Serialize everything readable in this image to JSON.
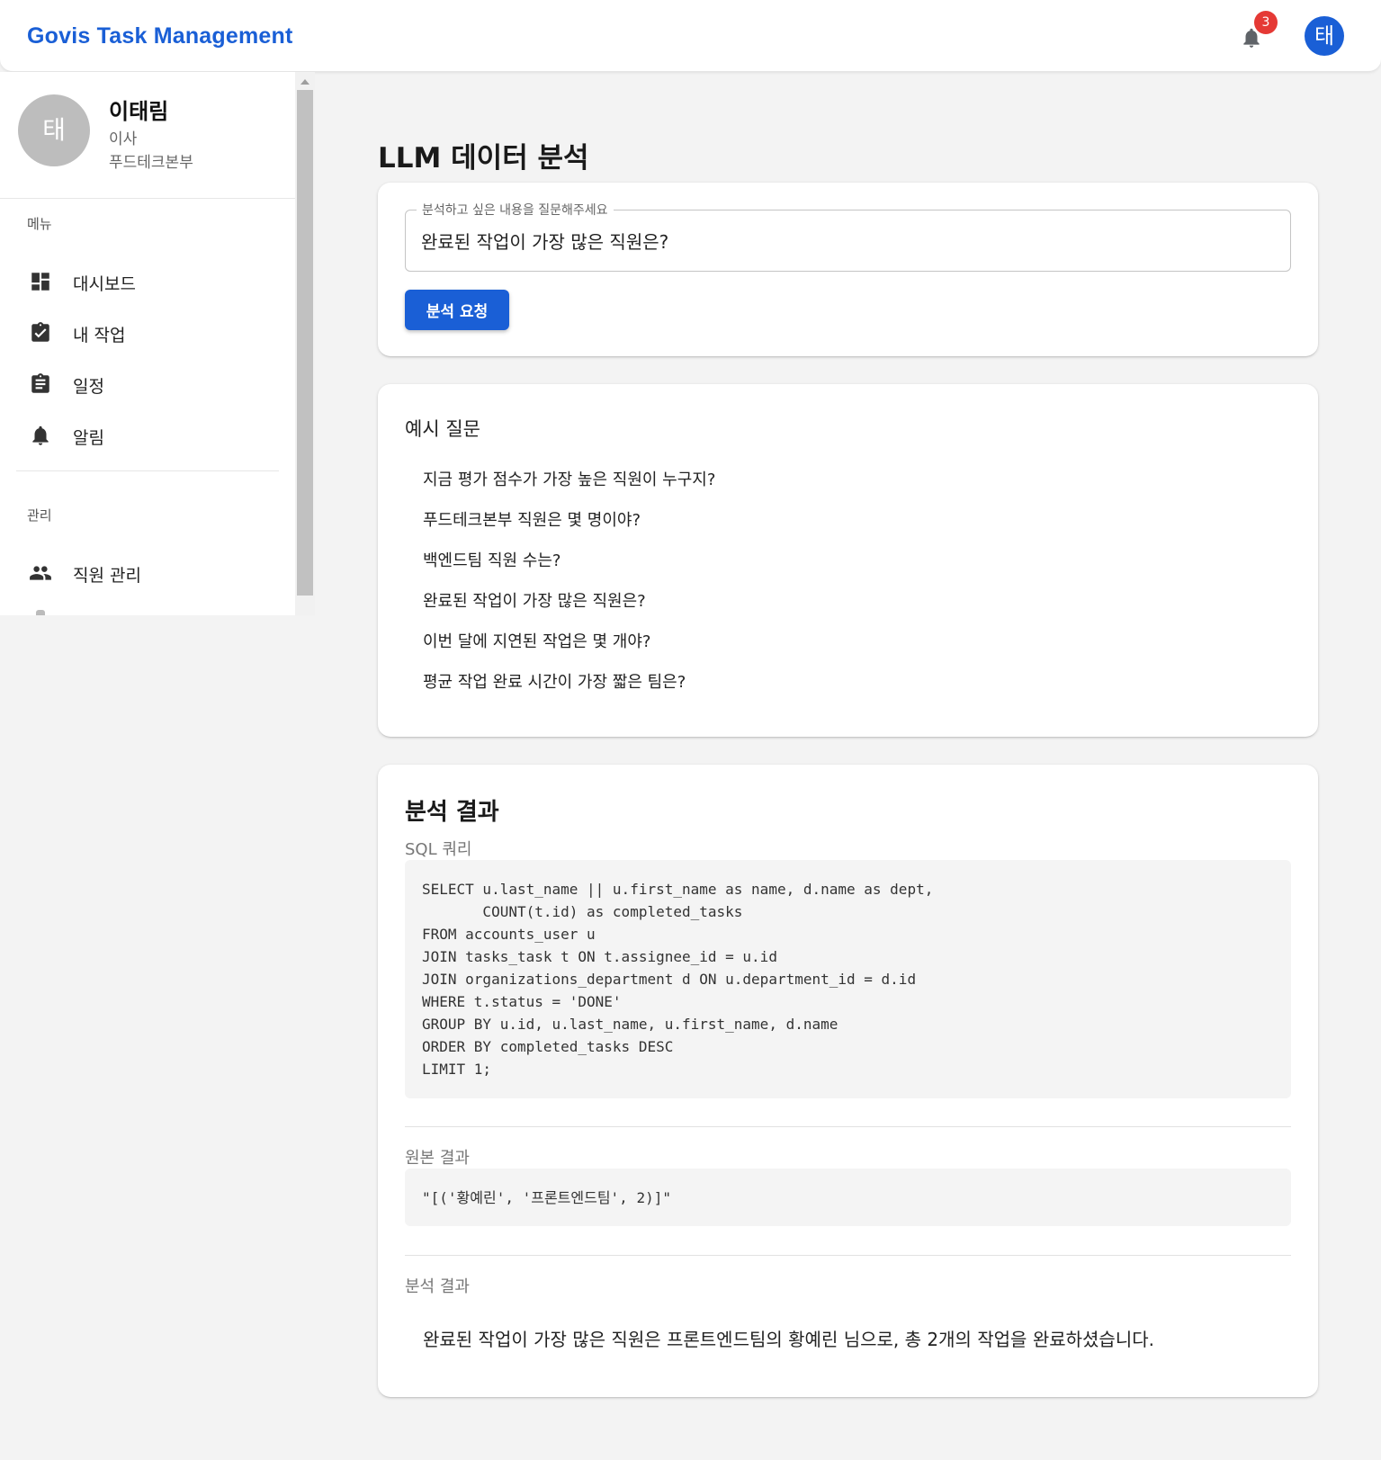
{
  "app": {
    "title": "Govis Task Management",
    "notification_count": "3",
    "user_initial": "태",
    "brand_color": "#1a5fd6",
    "badge_color": "#e53935"
  },
  "profile": {
    "initial": "태",
    "name": "이태림",
    "role": "이사",
    "department": "푸드테크본부"
  },
  "sidebar": {
    "menu_label": "메뉴",
    "menu_items": [
      {
        "label": "대시보드",
        "icon": "dashboard-icon"
      },
      {
        "label": "내 작업",
        "icon": "assignment-check-icon"
      },
      {
        "label": "일정",
        "icon": "clipboard-icon"
      },
      {
        "label": "알림",
        "icon": "bell-icon"
      }
    ],
    "admin_label": "관리",
    "admin_items": [
      {
        "label": "직원 관리",
        "icon": "people-icon"
      }
    ]
  },
  "main": {
    "page_title": "LLM 데이터 분석",
    "query": {
      "legend": "분석하고 싶은 내용을 질문해주세요",
      "value": "완료된 작업이 가장 많은 직원은?",
      "button_label": "분석 요청"
    },
    "examples": {
      "heading": "예시 질문",
      "items": [
        "지금 평가 점수가 가장 높은 직원이 누구지?",
        "푸드테크본부 직원은 몇 명이야?",
        "백엔드팀 직원 수는?",
        "완료된 작업이 가장 많은 직원은?",
        "이번 달에 지연된 작업은 몇 개야?",
        "평균 작업 완료 시간이 가장 짧은 팀은?"
      ]
    },
    "result": {
      "title": "분석 결과",
      "sql_label": "SQL 쿼리",
      "sql": "SELECT u.last_name || u.first_name as name, d.name as dept,\n       COUNT(t.id) as completed_tasks\nFROM accounts_user u\nJOIN tasks_task t ON t.assignee_id = u.id\nJOIN organizations_department d ON u.department_id = d.id\nWHERE t.status = 'DONE'\nGROUP BY u.id, u.last_name, u.first_name, d.name\nORDER BY completed_tasks DESC\nLIMIT 1;",
      "raw_label": "원본 결과",
      "raw": "\"[('황예린', '프론트엔드팀', 2)]\"",
      "analysis_label": "분석 결과",
      "analysis": "완료된 작업이 가장 많은 직원은 프론트엔드팀의 황예린 님으로, 총 2개의 작업을 완료하셨습니다."
    }
  }
}
